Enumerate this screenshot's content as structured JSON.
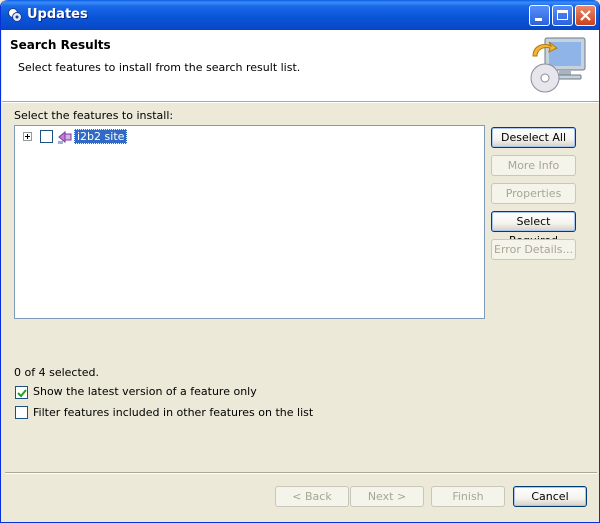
{
  "window": {
    "title": "Updates",
    "icon": "updates-app-icon"
  },
  "header": {
    "title": "Search Results",
    "description": "Select features to install from the search result list.",
    "image": "computer-update-banner"
  },
  "tree": {
    "label": "Select the features to install:",
    "items": [
      {
        "label": "i2b2 site",
        "checked": false,
        "expanded": false,
        "selected": true,
        "icon": "update-site-icon"
      }
    ]
  },
  "side_buttons": {
    "deselect_all": "Deselect All",
    "more_info": "More Info",
    "properties": "Properties",
    "select_required": "Select Required",
    "error_details": "Error Details..."
  },
  "status": "0 of 4 selected.",
  "options": {
    "latest_version": {
      "label": "Show the latest version of a feature only",
      "checked": true
    },
    "filter_included": {
      "label": "Filter features included in other features on the list",
      "checked": false
    }
  },
  "footer": {
    "back": "< Back",
    "next": "Next >",
    "finish": "Finish",
    "cancel": "Cancel"
  },
  "colors": {
    "titlebar": "#0a55d8",
    "selection": "#316ac5",
    "dialog_bg": "#ece9d8"
  }
}
